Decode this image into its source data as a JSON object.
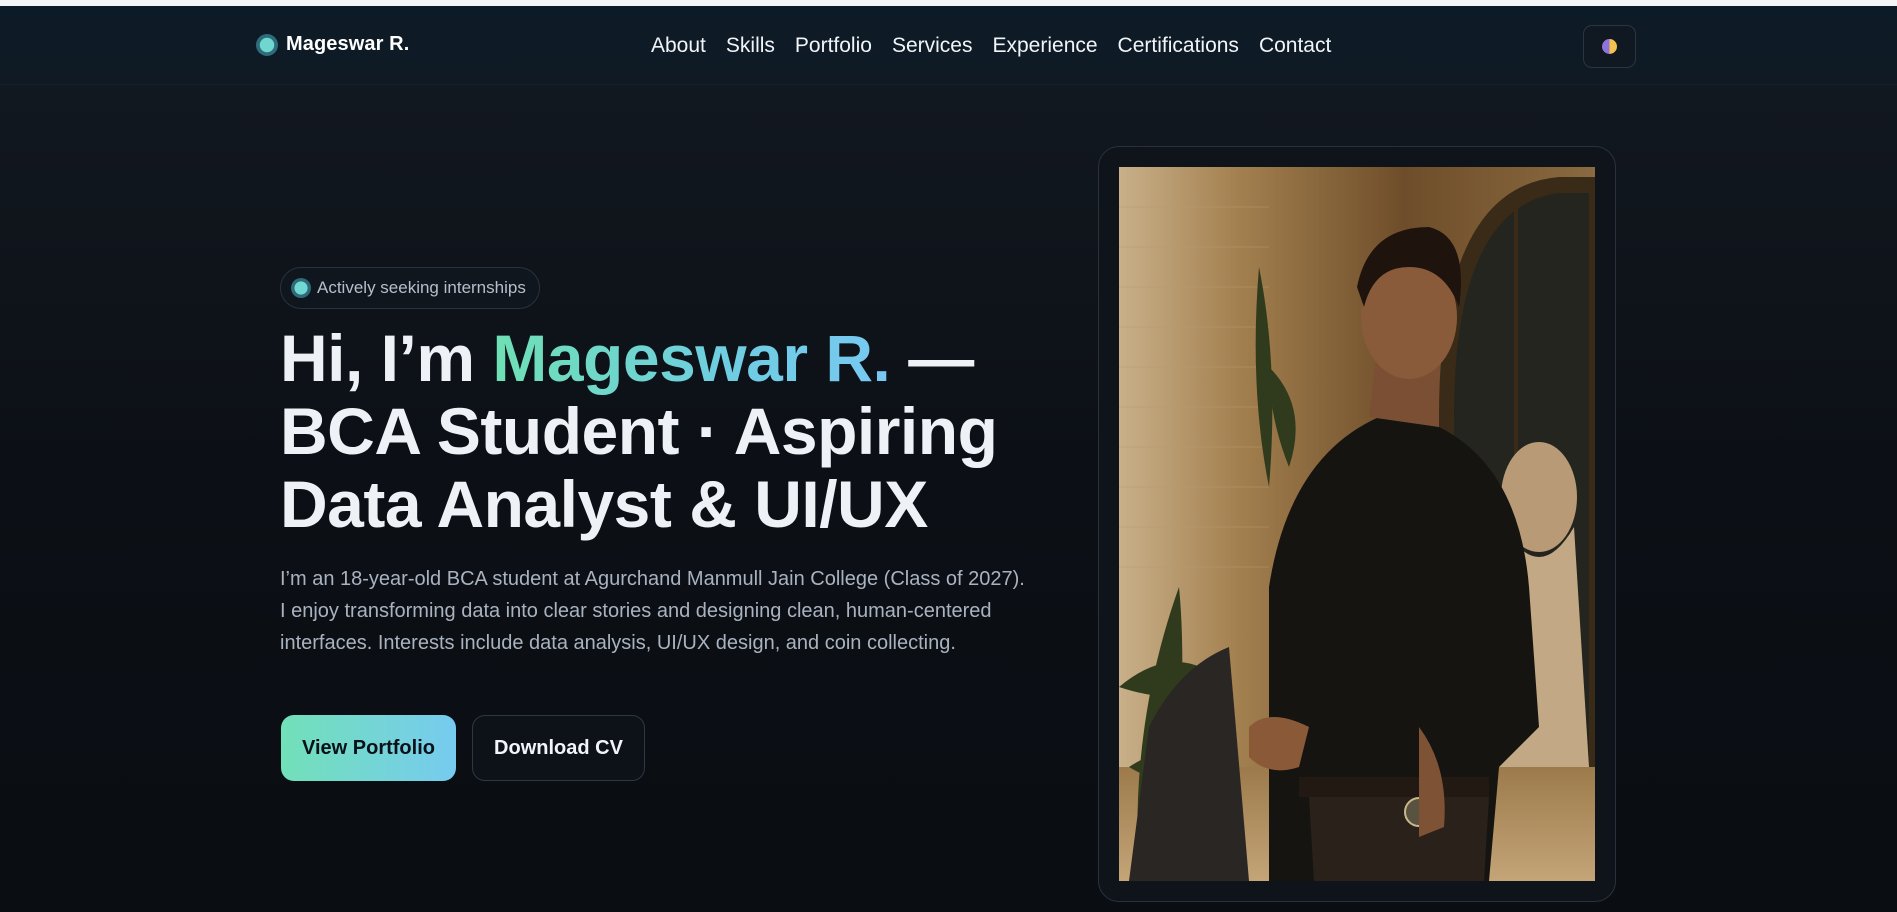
{
  "brand": {
    "name": "Mageswar R."
  },
  "nav": {
    "links": [
      "About",
      "Skills",
      "Portfolio",
      "Services",
      "Experience",
      "Certifications",
      "Contact"
    ],
    "theme_toggle_icon": "half-moon-icon"
  },
  "hero": {
    "status_pill": "Actively seeking internships",
    "headline": {
      "prefix": "Hi, I’m ",
      "name": "Mageswar R.",
      "suffix_line1": " —",
      "line2": "BCA Student · Aspiring",
      "line3": "Data Analyst & UI/UX"
    },
    "intro": "I’m an 18-year-old BCA student at Agurchand Manmull Jain College (Class of 2027). I enjoy transforming data into clear stories and designing clean, human-centered interfaces. Interests include data analysis, UI/UX design, and coin collecting.",
    "primary_button": "View Portfolio",
    "secondary_button": "Download CV"
  },
  "colors": {
    "background": "#0b0f15",
    "accent_start": "#6fe0b4",
    "accent_end": "#78c8f2",
    "text": "#eef1f6",
    "muted_text": "#a9b3c0"
  }
}
